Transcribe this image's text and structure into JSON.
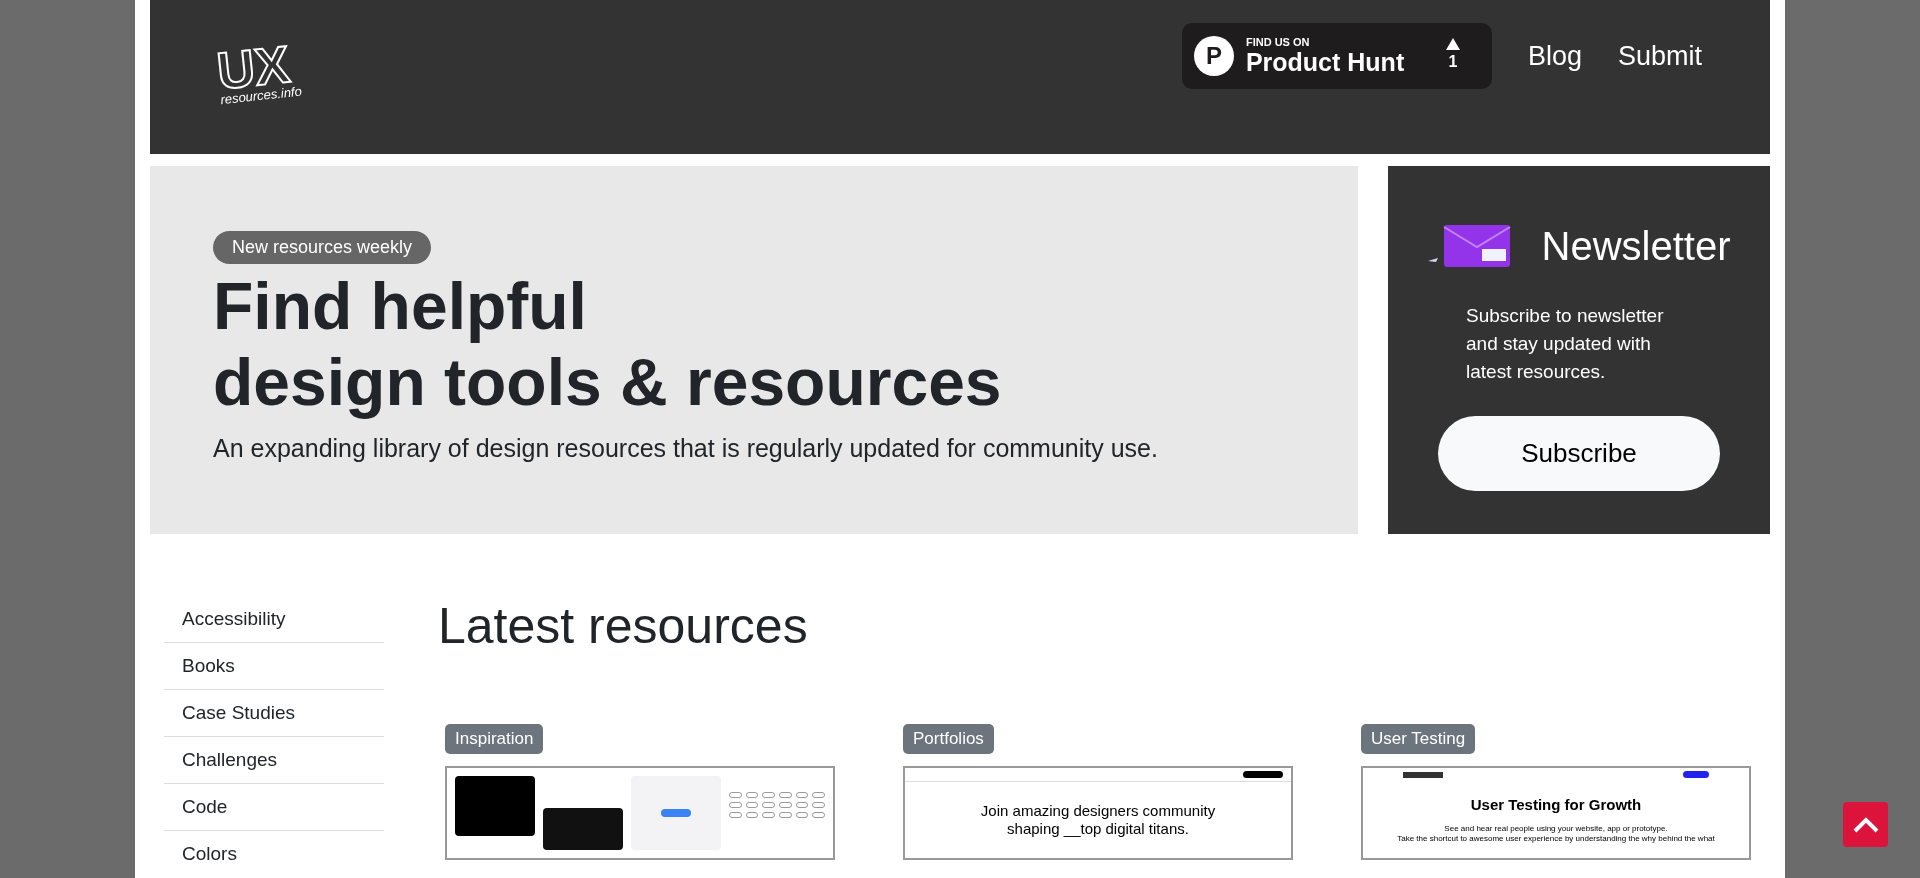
{
  "header": {
    "logo": {
      "big": "UX",
      "small": "resources.info"
    },
    "product_hunt": {
      "kicker": "FIND US ON",
      "name": "Product Hunt",
      "votes": "1",
      "letter": "P"
    },
    "nav": [
      "Blog",
      "Submit"
    ]
  },
  "hero": {
    "badge": "New resources weekly",
    "title_lines": [
      "Find helpful",
      "design tools & resources"
    ],
    "subtitle": "An expanding library of design resources that is regularly updated for community use."
  },
  "newsletter": {
    "title": "Newsletter",
    "text": "Subscribe to newsletter and stay updated with latest resources.",
    "button": "Subscribe"
  },
  "sidebar": {
    "items": [
      "Accessibility",
      "Books",
      "Case Studies",
      "Challenges",
      "Code",
      "Colors"
    ]
  },
  "main": {
    "heading": "Latest resources"
  },
  "cards": [
    {
      "kind": "gallery",
      "tag": "Inspiration"
    },
    {
      "kind": "portfolio",
      "tag": "Portfolios",
      "lines": [
        "Join amazing designers community",
        "shaping __top digital titans."
      ]
    },
    {
      "kind": "landing",
      "tag": "User Testing",
      "lines": [
        "User Testing for Growth",
        "See and hear real people using your website, app or prototype.",
        "Take the shortcut to awesome user experience by understanding the why behind the what"
      ]
    }
  ]
}
